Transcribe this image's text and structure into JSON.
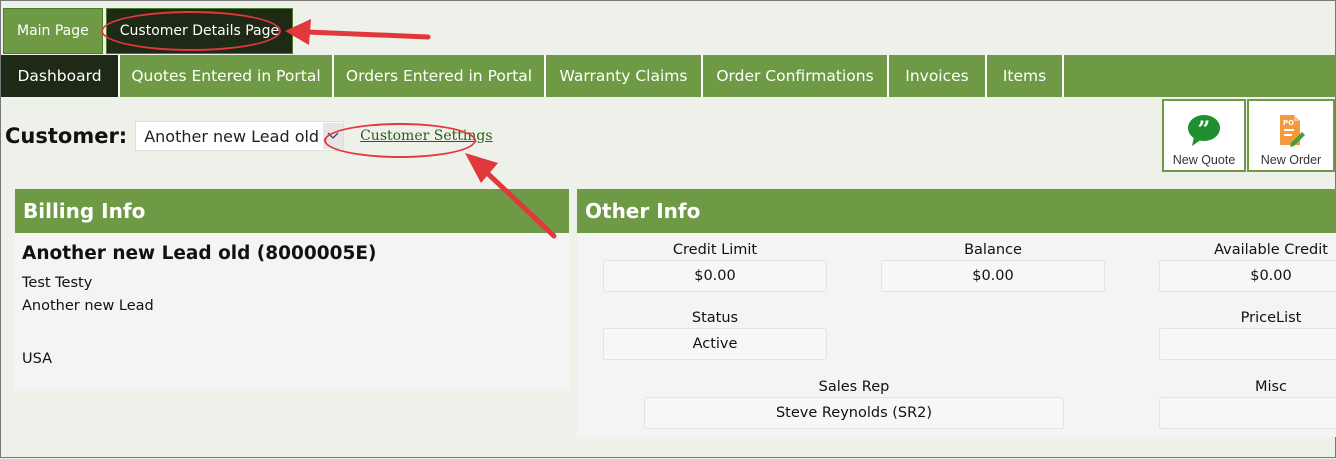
{
  "top_tabs": [
    "Main Page",
    "Customer Details Page"
  ],
  "nav_tabs": [
    "Dashboard",
    "Quotes Entered in Portal",
    "Orders Entered in Portal",
    "Warranty Claims",
    "Order Confirmations",
    "Invoices",
    "Items"
  ],
  "customer": {
    "label": "Customer:",
    "selected": "Another new Lead old",
    "settings_link": "Customer Settings"
  },
  "actions": {
    "new_quote": "New Quote",
    "new_order": "New Order"
  },
  "billing": {
    "header": "Billing Info",
    "name": "Another new Lead old (8000005E)",
    "contact": "Test Testy",
    "company": "Another new Lead",
    "country": "USA"
  },
  "other": {
    "header": "Other Info",
    "credit_limit_label": "Credit Limit",
    "credit_limit": "$0.00",
    "balance_label": "Balance",
    "balance": "$0.00",
    "available_credit_label": "Available Credit",
    "available_credit": "$0.00",
    "status_label": "Status",
    "status": "Active",
    "pricelist_label": "PriceList",
    "pricelist": "",
    "sales_rep_label": "Sales Rep",
    "sales_rep": "Steve Reynolds (SR2)",
    "misc_label": "Misc",
    "misc": ""
  },
  "colors": {
    "accent": "#6e9a46",
    "active_tab": "#1e2a15",
    "annotation": "#e0383b"
  },
  "icons": {
    "quote": "quote-bubble-icon",
    "order": "po-document-icon"
  }
}
